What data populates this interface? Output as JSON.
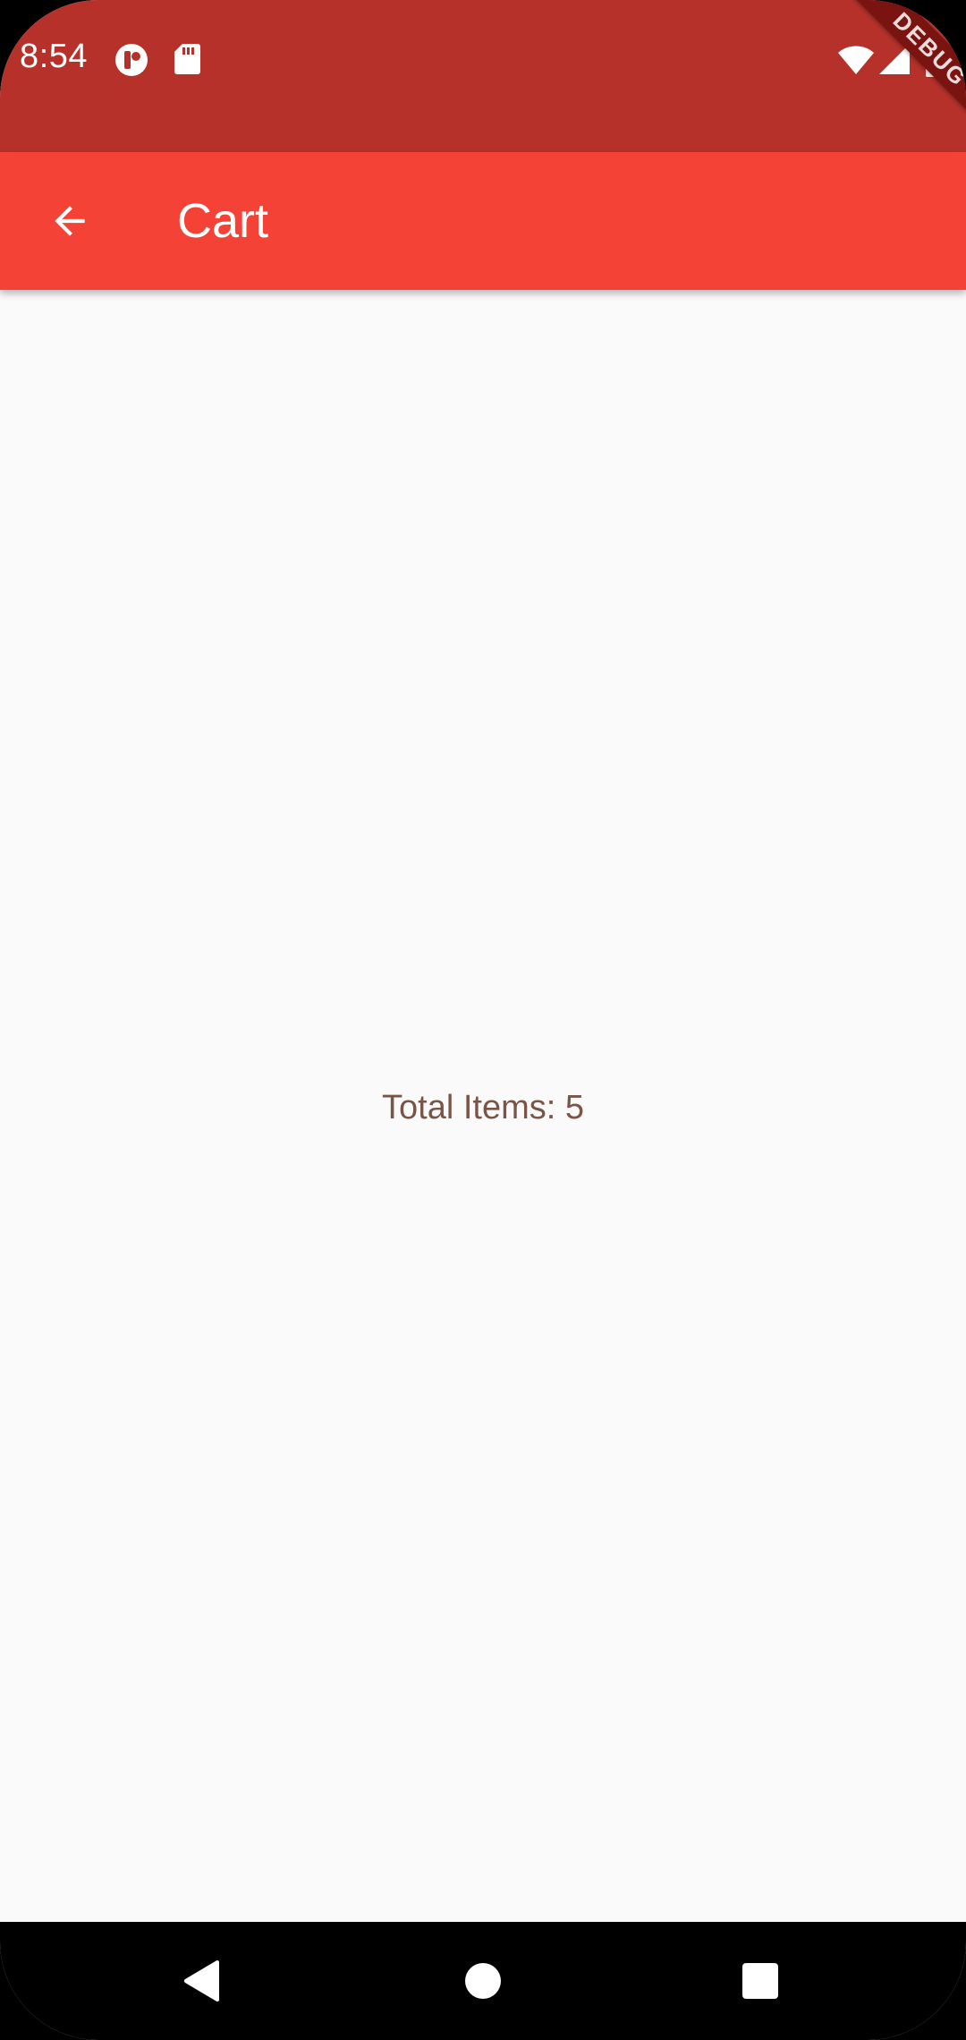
{
  "status_bar": {
    "time": "8:54",
    "left_icons": [
      "app-notification-icon",
      "sd-card-icon"
    ],
    "right_icons": [
      "wifi-icon",
      "cell-signal-icon",
      "battery-icon"
    ],
    "background_color": "#B7312B"
  },
  "debug_banner": {
    "label": "DEBUG"
  },
  "app_bar": {
    "title": "Cart",
    "back_icon": "arrow-back-icon",
    "background_color": "#F44336"
  },
  "content": {
    "total_items": "Total Items: 5",
    "text_color": "#795548"
  },
  "nav_bar": {
    "buttons": [
      "back-triangle-icon",
      "home-circle-icon",
      "recents-square-icon"
    ]
  }
}
